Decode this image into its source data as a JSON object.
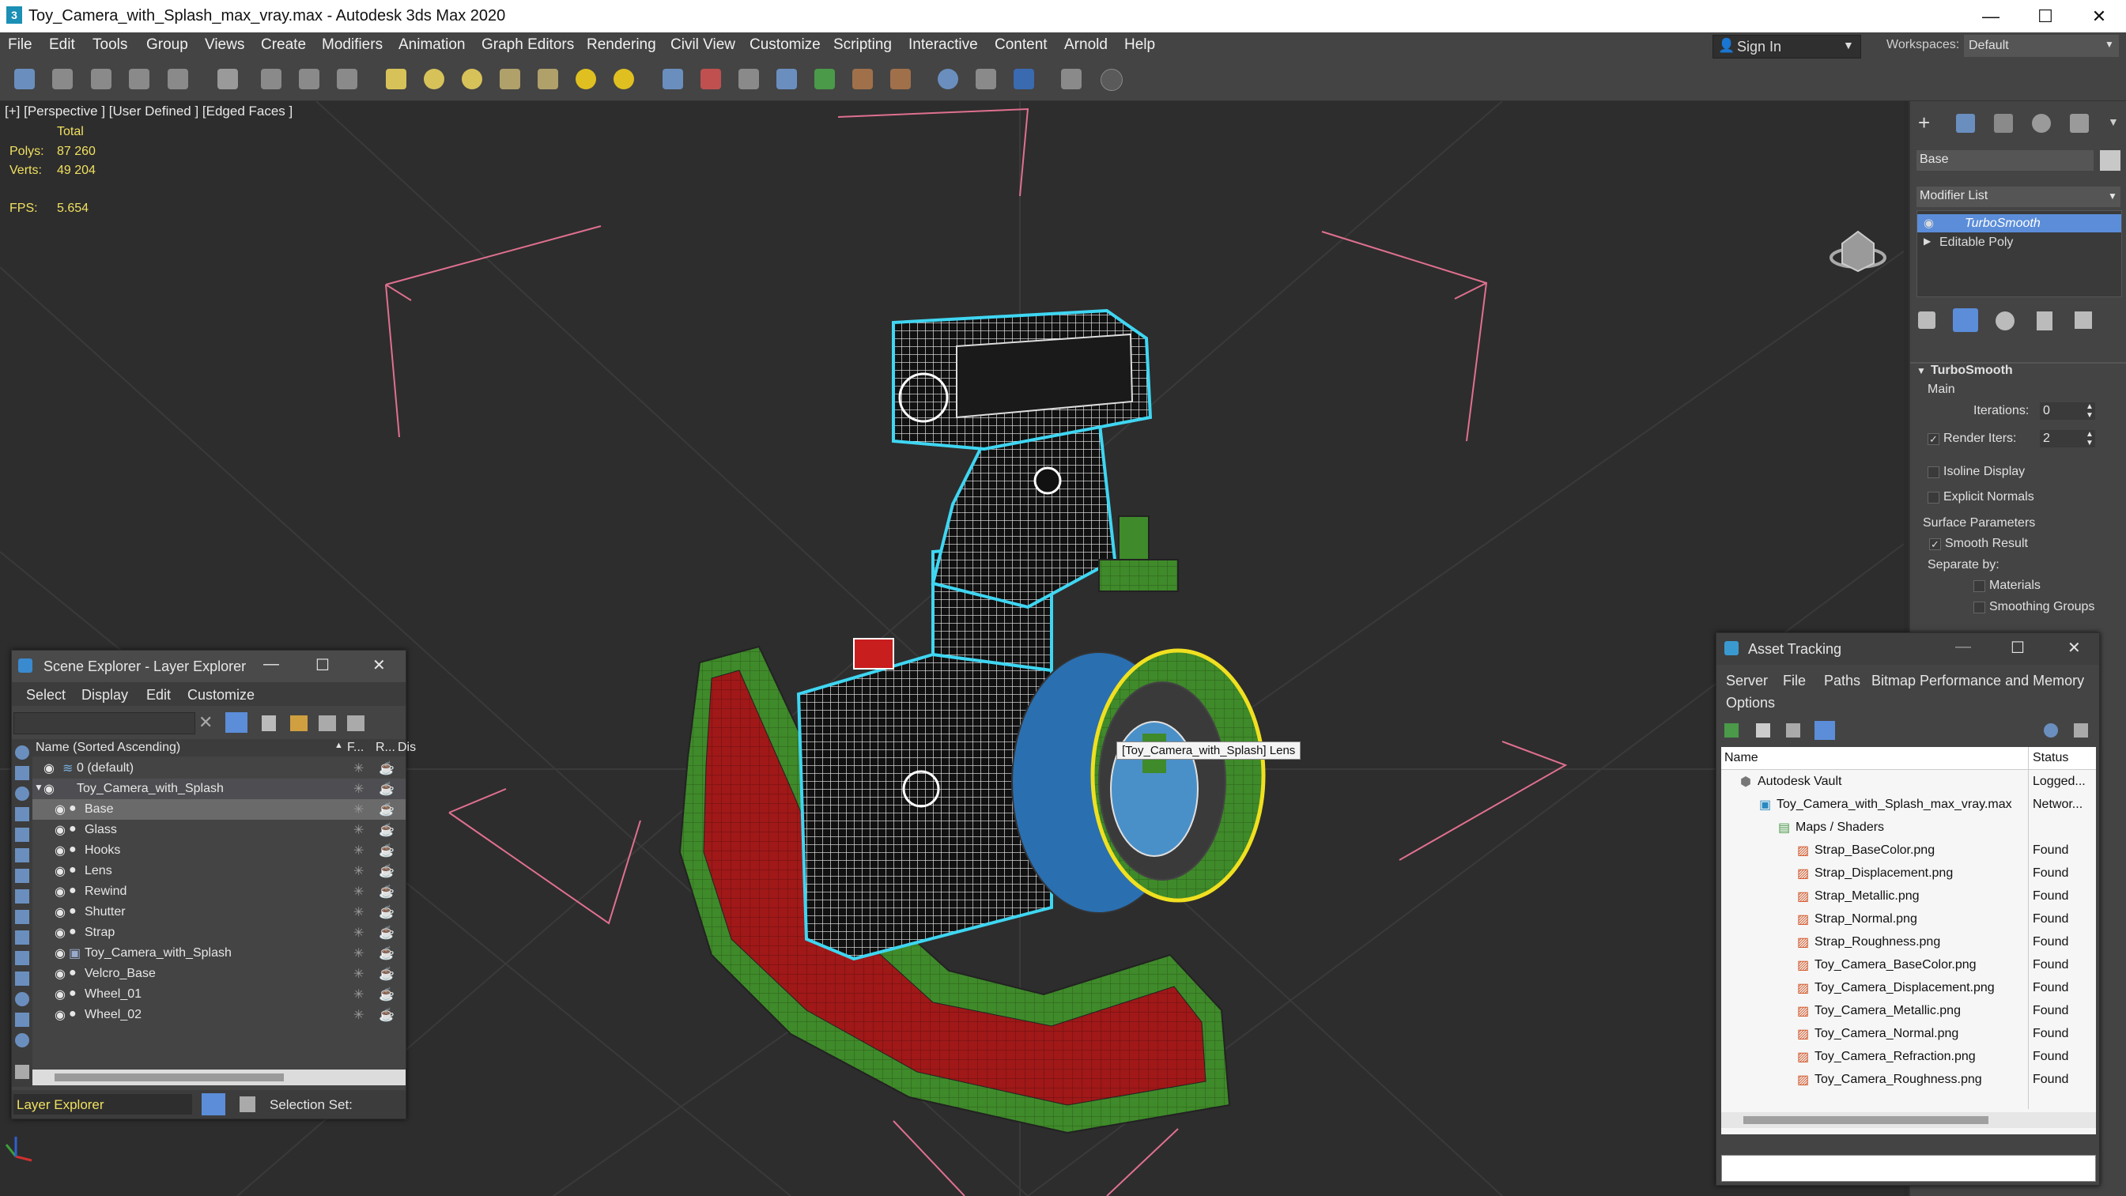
{
  "window": {
    "title": "Toy_Camera_with_Splash_max_vray.max - Autodesk 3ds Max 2020",
    "logo": "3",
    "minimize": "—",
    "maximize": "☐",
    "close": "✕"
  },
  "menu": [
    "File",
    "Edit",
    "Tools",
    "Group",
    "Views",
    "Create",
    "Modifiers",
    "Animation",
    "Graph Editors",
    "Rendering",
    "Civil View",
    "Customize",
    "Scripting",
    "Interactive",
    "Content",
    "Arnold",
    "Help"
  ],
  "account": {
    "sign_in": "Sign In",
    "workspaces_label": "Workspaces:",
    "workspace_value": "Default"
  },
  "viewport": {
    "label": "[+] [Perspective ] [User Defined ] [Edged Faces ]",
    "stats": {
      "total": "Total",
      "polys_label": "Polys:",
      "polys_value": "87 260",
      "verts_label": "Verts:",
      "verts_value": "49 204",
      "fps_label": "FPS:",
      "fps_value": "5.654"
    },
    "tooltip": "[Toy_Camera_with_Splash] Lens",
    "axis_x": "x",
    "axis_y": "y",
    "axis_z": "z"
  },
  "command_panel": {
    "object_name": "Base",
    "modifier_list": "Modifier List",
    "stack": [
      "TurboSmooth",
      "Editable Poly"
    ],
    "rollout_title": "TurboSmooth",
    "main": "Main",
    "iterations_label": "Iterations:",
    "iterations_value": "0",
    "render_iters_label": "Render Iters:",
    "render_iters_value": "2",
    "isoline_display": "Isoline Display",
    "explicit_normals": "Explicit Normals",
    "surface_parameters": "Surface Parameters",
    "smooth_result": "Smooth Result",
    "separate_by": "Separate by:",
    "materials": "Materials",
    "smoothing_groups": "Smoothing Groups"
  },
  "scene_explorer": {
    "title": "Scene Explorer - Layer Explorer",
    "menu": [
      "Select",
      "Display",
      "Edit",
      "Customize"
    ],
    "col_name": "Name (Sorted Ascending)",
    "col_f": "F...",
    "col_r": "R...",
    "col_dis": "Dis",
    "rows": [
      {
        "name": "0 (default)",
        "indent": 0
      },
      {
        "name": "Toy_Camera_with_Splash",
        "indent": 1
      },
      {
        "name": "Base",
        "indent": 2
      },
      {
        "name": "Glass",
        "indent": 2
      },
      {
        "name": "Hooks",
        "indent": 2
      },
      {
        "name": "Lens",
        "indent": 2
      },
      {
        "name": "Rewind",
        "indent": 2
      },
      {
        "name": "Shutter",
        "indent": 2
      },
      {
        "name": "Strap",
        "indent": 2
      },
      {
        "name": "Toy_Camera_with_Splash",
        "indent": 2
      },
      {
        "name": "Velcro_Base",
        "indent": 2
      },
      {
        "name": "Wheel_01",
        "indent": 2
      },
      {
        "name": "Wheel_02",
        "indent": 2
      }
    ],
    "footer_mode": "Layer Explorer",
    "selection_set_label": "Selection Set:"
  },
  "asset_tracking": {
    "title": "Asset Tracking",
    "menu": [
      "Server",
      "File",
      "Paths",
      "Bitmap Performance and Memory"
    ],
    "menu2": "Options",
    "col_name": "Name",
    "col_status": "Status",
    "rows": [
      {
        "name": "Autodesk Vault",
        "status": "Logged..."
      },
      {
        "name": "Toy_Camera_with_Splash_max_vray.max",
        "status": "Networ..."
      },
      {
        "name": "Maps / Shaders",
        "status": ""
      },
      {
        "name": "Strap_BaseColor.png",
        "status": "Found"
      },
      {
        "name": "Strap_Displacement.png",
        "status": "Found"
      },
      {
        "name": "Strap_Metallic.png",
        "status": "Found"
      },
      {
        "name": "Strap_Normal.png",
        "status": "Found"
      },
      {
        "name": "Strap_Roughness.png",
        "status": "Found"
      },
      {
        "name": "Toy_Camera_BaseColor.png",
        "status": "Found"
      },
      {
        "name": "Toy_Camera_Displacement.png",
        "status": "Found"
      },
      {
        "name": "Toy_Camera_Metallic.png",
        "status": "Found"
      },
      {
        "name": "Toy_Camera_Normal.png",
        "status": "Found"
      },
      {
        "name": "Toy_Camera_Refraction.png",
        "status": "Found"
      },
      {
        "name": "Toy_Camera_Roughness.png",
        "status": "Found"
      }
    ]
  },
  "colors": {
    "accent": "#5b8dd9",
    "selection_cyan": "#4fd8f0",
    "selection_yellow": "#f0e020",
    "stats_yellow": "#f0e060"
  }
}
